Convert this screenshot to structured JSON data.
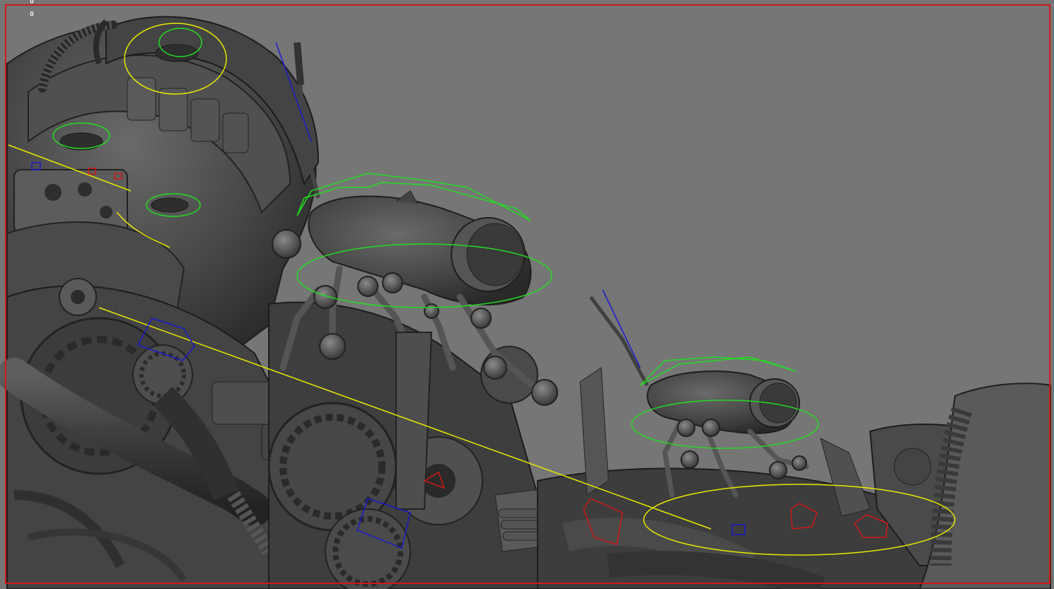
{
  "viewport": {
    "hud_values": [
      "0",
      "0"
    ],
    "frame_color": "#d01818",
    "background_color": "#767676",
    "rig_colors": {
      "fk_controls": "#22dd22",
      "ik_handles": "#e8e800",
      "left_locators": "#1a1acc",
      "right_locators": "#d01818"
    }
  }
}
